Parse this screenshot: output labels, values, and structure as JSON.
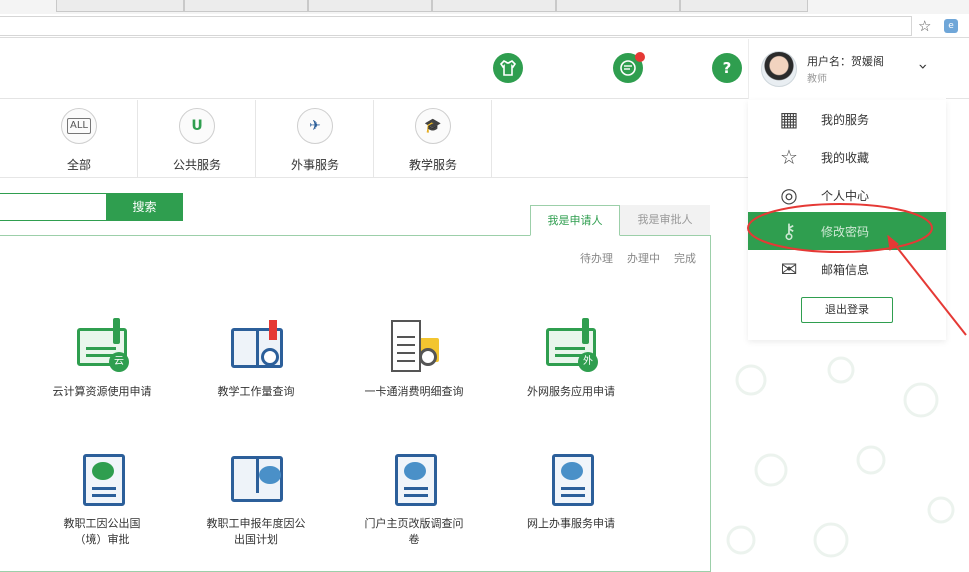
{
  "header": {
    "icons": [
      "shirt-icon",
      "notification-icon",
      "help-icon"
    ],
    "help_glyph": "?",
    "user": {
      "name": "用户名：贺媛阁",
      "role": "教师"
    }
  },
  "categories": [
    {
      "label": "全部",
      "icon": "all-icon",
      "glyph": "ALL"
    },
    {
      "label": "公共服务",
      "icon": "public-service-icon",
      "glyph": "U"
    },
    {
      "label": "外事服务",
      "icon": "airplane-icon",
      "glyph": "✈"
    },
    {
      "label": "教学服务",
      "icon": "graduation-cap-icon",
      "glyph": "🎓"
    }
  ],
  "search": {
    "button_label": "搜索",
    "value": ""
  },
  "panel": {
    "tabs": [
      "我是申请人",
      "我是审批人"
    ],
    "status_filters": [
      "待办理",
      "办理中",
      "完成"
    ],
    "apps": [
      {
        "label": "云计算资源使用申请",
        "icon": "cloud-computing-icon",
        "badge": "云"
      },
      {
        "label": "教学工作量查询",
        "icon": "teaching-workload-icon"
      },
      {
        "label": "一卡通消费明细查询",
        "icon": "card-consumption-icon"
      },
      {
        "label": "外网服务应用申请",
        "icon": "external-network-icon",
        "badge": "外"
      },
      {
        "label_lines": [
          "教职工因公出国",
          "（境）审批"
        ],
        "icon": "travel-approval-icon"
      },
      {
        "label_lines": [
          "教职工申报年度因公",
          "出国计划"
        ],
        "icon": "annual-plan-icon"
      },
      {
        "label_lines": [
          "门户主页改版调查问",
          "卷"
        ],
        "icon": "survey-icon"
      },
      {
        "label": "网上办事服务申请",
        "icon": "online-service-icon"
      }
    ]
  },
  "dropdown": {
    "items": [
      {
        "label": "我的服务",
        "icon": "grid-icon",
        "glyph": "▦"
      },
      {
        "label": "我的收藏",
        "icon": "star-icon",
        "glyph": "☆"
      },
      {
        "label": "个人中心",
        "icon": "user-icon",
        "glyph": "◎"
      },
      {
        "label": "修改密码",
        "icon": "key-icon",
        "glyph": "⚷",
        "highlighted": true
      },
      {
        "label": "邮箱信息",
        "icon": "mail-icon",
        "glyph": "✉"
      }
    ],
    "logout_label": "退出登录"
  },
  "browser": {
    "star_glyph": "☆",
    "extension_glyph": "e"
  },
  "colors": {
    "brand_green": "#2f9e4f",
    "annotation_red": "#e53935"
  }
}
